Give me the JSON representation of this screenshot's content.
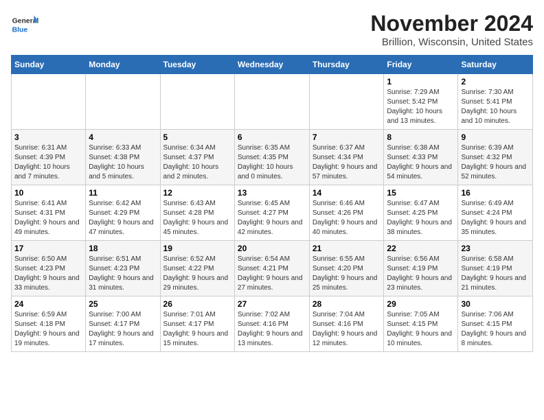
{
  "header": {
    "logo_general": "General",
    "logo_blue": "Blue",
    "month_title": "November 2024",
    "location": "Brillion, Wisconsin, United States"
  },
  "weekdays": [
    "Sunday",
    "Monday",
    "Tuesday",
    "Wednesday",
    "Thursday",
    "Friday",
    "Saturday"
  ],
  "weeks": [
    [
      {
        "day": "",
        "info": ""
      },
      {
        "day": "",
        "info": ""
      },
      {
        "day": "",
        "info": ""
      },
      {
        "day": "",
        "info": ""
      },
      {
        "day": "",
        "info": ""
      },
      {
        "day": "1",
        "info": "Sunrise: 7:29 AM\nSunset: 5:42 PM\nDaylight: 10 hours and 13 minutes."
      },
      {
        "day": "2",
        "info": "Sunrise: 7:30 AM\nSunset: 5:41 PM\nDaylight: 10 hours and 10 minutes."
      }
    ],
    [
      {
        "day": "3",
        "info": "Sunrise: 6:31 AM\nSunset: 4:39 PM\nDaylight: 10 hours and 7 minutes."
      },
      {
        "day": "4",
        "info": "Sunrise: 6:33 AM\nSunset: 4:38 PM\nDaylight: 10 hours and 5 minutes."
      },
      {
        "day": "5",
        "info": "Sunrise: 6:34 AM\nSunset: 4:37 PM\nDaylight: 10 hours and 2 minutes."
      },
      {
        "day": "6",
        "info": "Sunrise: 6:35 AM\nSunset: 4:35 PM\nDaylight: 10 hours and 0 minutes."
      },
      {
        "day": "7",
        "info": "Sunrise: 6:37 AM\nSunset: 4:34 PM\nDaylight: 9 hours and 57 minutes."
      },
      {
        "day": "8",
        "info": "Sunrise: 6:38 AM\nSunset: 4:33 PM\nDaylight: 9 hours and 54 minutes."
      },
      {
        "day": "9",
        "info": "Sunrise: 6:39 AM\nSunset: 4:32 PM\nDaylight: 9 hours and 52 minutes."
      }
    ],
    [
      {
        "day": "10",
        "info": "Sunrise: 6:41 AM\nSunset: 4:31 PM\nDaylight: 9 hours and 49 minutes."
      },
      {
        "day": "11",
        "info": "Sunrise: 6:42 AM\nSunset: 4:29 PM\nDaylight: 9 hours and 47 minutes."
      },
      {
        "day": "12",
        "info": "Sunrise: 6:43 AM\nSunset: 4:28 PM\nDaylight: 9 hours and 45 minutes."
      },
      {
        "day": "13",
        "info": "Sunrise: 6:45 AM\nSunset: 4:27 PM\nDaylight: 9 hours and 42 minutes."
      },
      {
        "day": "14",
        "info": "Sunrise: 6:46 AM\nSunset: 4:26 PM\nDaylight: 9 hours and 40 minutes."
      },
      {
        "day": "15",
        "info": "Sunrise: 6:47 AM\nSunset: 4:25 PM\nDaylight: 9 hours and 38 minutes."
      },
      {
        "day": "16",
        "info": "Sunrise: 6:49 AM\nSunset: 4:24 PM\nDaylight: 9 hours and 35 minutes."
      }
    ],
    [
      {
        "day": "17",
        "info": "Sunrise: 6:50 AM\nSunset: 4:23 PM\nDaylight: 9 hours and 33 minutes."
      },
      {
        "day": "18",
        "info": "Sunrise: 6:51 AM\nSunset: 4:23 PM\nDaylight: 9 hours and 31 minutes."
      },
      {
        "day": "19",
        "info": "Sunrise: 6:52 AM\nSunset: 4:22 PM\nDaylight: 9 hours and 29 minutes."
      },
      {
        "day": "20",
        "info": "Sunrise: 6:54 AM\nSunset: 4:21 PM\nDaylight: 9 hours and 27 minutes."
      },
      {
        "day": "21",
        "info": "Sunrise: 6:55 AM\nSunset: 4:20 PM\nDaylight: 9 hours and 25 minutes."
      },
      {
        "day": "22",
        "info": "Sunrise: 6:56 AM\nSunset: 4:19 PM\nDaylight: 9 hours and 23 minutes."
      },
      {
        "day": "23",
        "info": "Sunrise: 6:58 AM\nSunset: 4:19 PM\nDaylight: 9 hours and 21 minutes."
      }
    ],
    [
      {
        "day": "24",
        "info": "Sunrise: 6:59 AM\nSunset: 4:18 PM\nDaylight: 9 hours and 19 minutes."
      },
      {
        "day": "25",
        "info": "Sunrise: 7:00 AM\nSunset: 4:17 PM\nDaylight: 9 hours and 17 minutes."
      },
      {
        "day": "26",
        "info": "Sunrise: 7:01 AM\nSunset: 4:17 PM\nDaylight: 9 hours and 15 minutes."
      },
      {
        "day": "27",
        "info": "Sunrise: 7:02 AM\nSunset: 4:16 PM\nDaylight: 9 hours and 13 minutes."
      },
      {
        "day": "28",
        "info": "Sunrise: 7:04 AM\nSunset: 4:16 PM\nDaylight: 9 hours and 12 minutes."
      },
      {
        "day": "29",
        "info": "Sunrise: 7:05 AM\nSunset: 4:15 PM\nDaylight: 9 hours and 10 minutes."
      },
      {
        "day": "30",
        "info": "Sunrise: 7:06 AM\nSunset: 4:15 PM\nDaylight: 9 hours and 8 minutes."
      }
    ]
  ]
}
